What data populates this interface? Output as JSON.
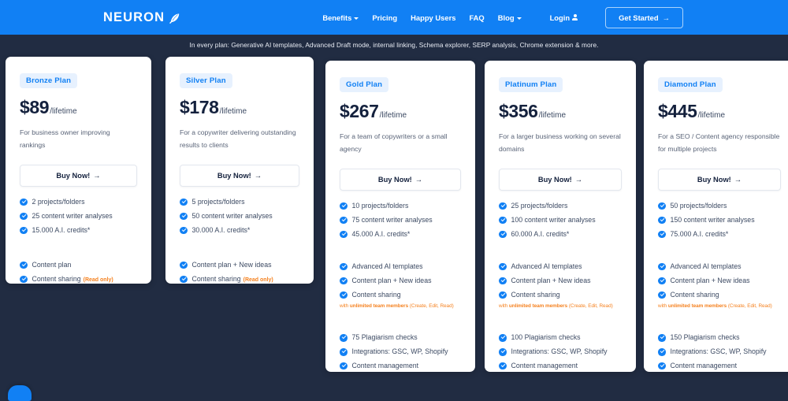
{
  "navbar": {
    "brand": "NEURON",
    "brand_icon": "feather-icon",
    "accent_color": "#1180f4",
    "links": [
      {
        "label": "Benefits",
        "has_caret": true
      },
      {
        "label": "Pricing",
        "has_caret": false
      },
      {
        "label": "Happy Users",
        "has_caret": false
      },
      {
        "label": "FAQ",
        "has_caret": false
      },
      {
        "label": "Blog",
        "has_caret": true
      }
    ],
    "login_label": "Login",
    "login_icon": "user-icon",
    "cta_label": "Get Started",
    "cta_arrow": "→"
  },
  "banner": {
    "text": "In every plan: Generative AI templates, Advanced Draft mode, internal linking, Schema explorer, SERP analysis, Chrome extension & more.",
    "background": "#212c42"
  },
  "buy_label": "Buy Now!",
  "buy_arrow": "→",
  "period": "/lifetime",
  "orange_color": "#f58220",
  "plans": [
    {
      "badge": "Bronze Plan",
      "price": "$89",
      "tagline": "For business owner improving rankings",
      "group1": [
        "2 projects/folders",
        "25 content writer analyses",
        "15.000 A.I. credits*"
      ],
      "group2": [
        "Content plan"
      ],
      "sharing_label": "Content sharing",
      "sharing_note": "(Read only)",
      "subnote_plain": null,
      "subnote_bold": null,
      "subnote_tail": null,
      "group3": []
    },
    {
      "badge": "Silver Plan",
      "price": "$178",
      "tagline": "For a copywriter delivering outstanding results to clients",
      "group1": [
        "5 projects/folders",
        "50 content writer analyses",
        "30.000 A.I. credits*"
      ],
      "group2": [
        "Content plan + New ideas"
      ],
      "sharing_label": "Content sharing",
      "sharing_note": "(Read only)",
      "subnote_plain": null,
      "subnote_bold": null,
      "subnote_tail": null,
      "group3": []
    },
    {
      "badge": "Gold Plan",
      "price": "$267",
      "tagline": "For a team of copywriters or a small agency",
      "group1": [
        "10 projects/folders",
        "75 content writer analyses",
        "45.000 A.I. credits*"
      ],
      "group2": [
        "Advanced AI templates",
        "Content plan + New ideas"
      ],
      "sharing_label": "Content sharing",
      "sharing_note": null,
      "subnote_plain": "with ",
      "subnote_bold": "unlimited team members",
      "subnote_tail": " (Create, Edit, Read)",
      "group3": [
        "75 Plagiarism checks",
        "Integrations: GSC, WP, Shopify",
        "Content management"
      ]
    },
    {
      "badge": "Platinum Plan",
      "price": "$356",
      "tagline": "For a larger business working on several domains",
      "group1": [
        "25 projects/folders",
        "100 content writer analyses",
        "60.000 A.I. credits*"
      ],
      "group2": [
        "Advanced AI templates",
        "Content plan + New ideas"
      ],
      "sharing_label": "Content sharing",
      "sharing_note": null,
      "subnote_plain": "with ",
      "subnote_bold": "unlimited team members",
      "subnote_tail": " (Create, Edit, Read)",
      "group3": [
        "100 Plagiarism checks",
        "Integrations: GSC, WP, Shopify",
        "Content management"
      ]
    },
    {
      "badge": "Diamond Plan",
      "price": "$445",
      "tagline": "For a SEO / Content agency responsible for multiple projects",
      "group1": [
        "50 projects/folders",
        "150 content writer analyses",
        "75.000 A.I. credits*"
      ],
      "group2": [
        "Advanced AI templates",
        "Content plan + New ideas"
      ],
      "sharing_label": "Content sharing",
      "sharing_note": null,
      "subnote_plain": "with ",
      "subnote_bold": "unlimited team members",
      "subnote_tail": " (Create, Edit, Read)",
      "group3": [
        "150 Plagiarism checks",
        "Integrations: GSC, WP, Shopify",
        "Content management"
      ]
    }
  ],
  "chat_widget": {
    "icon": "chat-bubble-icon"
  }
}
